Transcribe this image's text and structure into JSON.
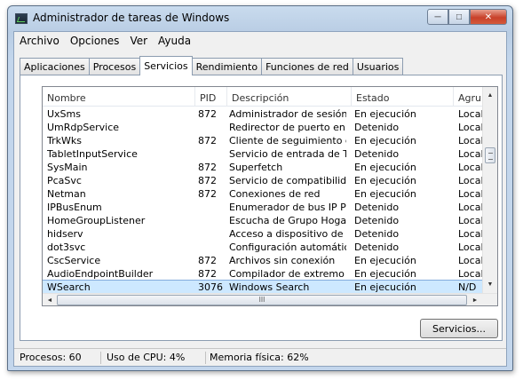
{
  "window": {
    "title": "Administrador de tareas de Windows",
    "minimize_glyph": "─",
    "maximize_glyph": "□",
    "close_glyph": "✕"
  },
  "menu": [
    "Archivo",
    "Opciones",
    "Ver",
    "Ayuda"
  ],
  "tabs": [
    {
      "label": "Aplicaciones",
      "active": false
    },
    {
      "label": "Procesos",
      "active": false
    },
    {
      "label": "Servicios",
      "active": true
    },
    {
      "label": "Rendimiento",
      "active": false
    },
    {
      "label": "Funciones de red",
      "active": false
    },
    {
      "label": "Usuarios",
      "active": false
    }
  ],
  "table": {
    "columns": [
      "Nombre",
      "PID",
      "Descripción",
      "Estado",
      "Agrup"
    ],
    "rows": [
      {
        "name": "UxSms",
        "pid": "872",
        "desc": "Administrador de sesión del ...",
        "state": "En ejecución",
        "group": "Local"
      },
      {
        "name": "UmRdpService",
        "pid": "",
        "desc": "Redirector de puerto en mo...",
        "state": "Detenido",
        "group": "Local"
      },
      {
        "name": "TrkWks",
        "pid": "872",
        "desc": "Cliente de seguimiento de ví...",
        "state": "En ejecución",
        "group": "Local"
      },
      {
        "name": "TabletInputService",
        "pid": "",
        "desc": "Servicio de entrada de Tabl...",
        "state": "Detenido",
        "group": "Local"
      },
      {
        "name": "SysMain",
        "pid": "872",
        "desc": "Superfetch",
        "state": "En ejecución",
        "group": "Local"
      },
      {
        "name": "PcaSvc",
        "pid": "872",
        "desc": "Servicio de compatibilidad d...",
        "state": "En ejecución",
        "group": "Local"
      },
      {
        "name": "Netman",
        "pid": "872",
        "desc": "Conexiones de red",
        "state": "En ejecución",
        "group": "Local"
      },
      {
        "name": "IPBusEnum",
        "pid": "",
        "desc": "Enumerador de bus IP PnP-X",
        "state": "Detenido",
        "group": "Local"
      },
      {
        "name": "HomeGroupListener",
        "pid": "",
        "desc": "Escucha de Grupo Hogar",
        "state": "Detenido",
        "group": "Local"
      },
      {
        "name": "hidserv",
        "pid": "",
        "desc": "Acceso a dispositivo de inte...",
        "state": "Detenido",
        "group": "Local"
      },
      {
        "name": "dot3svc",
        "pid": "",
        "desc": "Configuración automática d...",
        "state": "Detenido",
        "group": "Local"
      },
      {
        "name": "CscService",
        "pid": "872",
        "desc": "Archivos sin conexión",
        "state": "En ejecución",
        "group": "Local"
      },
      {
        "name": "AudioEndpointBuilder",
        "pid": "872",
        "desc": "Compilador de extremo de ...",
        "state": "En ejecución",
        "group": "Local"
      },
      {
        "name": "WSearch",
        "pid": "3076",
        "desc": "Windows Search",
        "state": "En ejecución",
        "group": "N/D",
        "selected": true
      }
    ]
  },
  "scroll_glyphs": {
    "up": "▲",
    "down": "▼",
    "left": "◄",
    "right": "►",
    "thumb": "III"
  },
  "services_button": "Servicios...",
  "status": {
    "processes": "Procesos: 60",
    "cpu": "Uso de CPU: 4%",
    "memory": "Memoria física: 62%"
  }
}
